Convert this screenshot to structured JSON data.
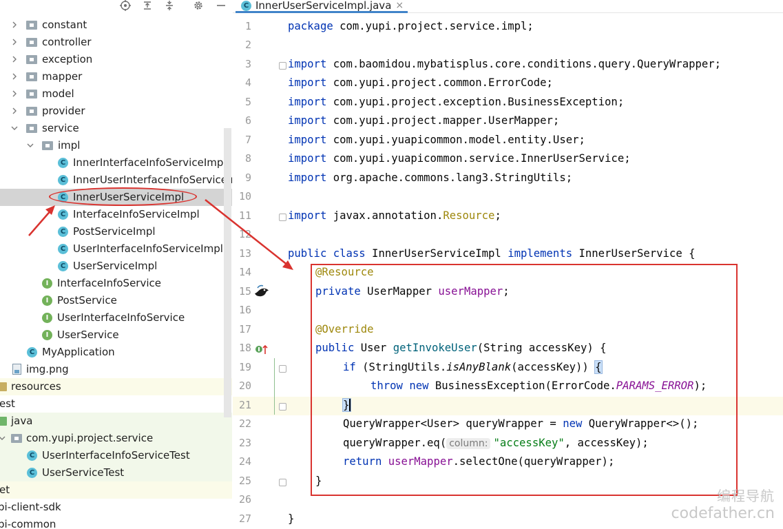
{
  "tree": {
    "items": [
      {
        "label": "constant",
        "type": "package"
      },
      {
        "label": "controller",
        "type": "package"
      },
      {
        "label": "exception",
        "type": "package"
      },
      {
        "label": "mapper",
        "type": "package"
      },
      {
        "label": "model",
        "type": "package"
      },
      {
        "label": "provider",
        "type": "package"
      },
      {
        "label": "service",
        "type": "package"
      },
      {
        "label": "impl",
        "type": "package"
      },
      {
        "label": "InnerInterfaceInfoServiceImpl",
        "type": "class"
      },
      {
        "label": "InnerUserInterfaceInfoServiceImpl",
        "type": "class"
      },
      {
        "label": "InnerUserServiceImpl",
        "type": "class"
      },
      {
        "label": "InterfaceInfoServiceImpl",
        "type": "class"
      },
      {
        "label": "PostServiceImpl",
        "type": "class"
      },
      {
        "label": "UserInterfaceInfoServiceImpl",
        "type": "class"
      },
      {
        "label": "UserServiceImpl",
        "type": "class"
      },
      {
        "label": "InterfaceInfoService",
        "type": "interface"
      },
      {
        "label": "PostService",
        "type": "interface"
      },
      {
        "label": "UserInterfaceInfoService",
        "type": "interface"
      },
      {
        "label": "UserService",
        "type": "interface"
      },
      {
        "label": "MyApplication",
        "type": "app-class"
      },
      {
        "label": "img.png",
        "type": "image"
      },
      {
        "label": "resources",
        "type": "resources"
      },
      {
        "label": "est",
        "type": "plain"
      },
      {
        "label": "java",
        "type": "java-folder"
      },
      {
        "label": "com.yupi.project.service",
        "type": "package"
      },
      {
        "label": "UserInterfaceInfoServiceTest",
        "type": "test-class"
      },
      {
        "label": "UserServiceTest",
        "type": "test-class"
      },
      {
        "label": "et",
        "type": "plain"
      },
      {
        "label": "pi-client-sdk",
        "type": "plain"
      },
      {
        "label": "pi-common",
        "type": "plain"
      }
    ]
  },
  "editor": {
    "tab": {
      "label": "InnerUserServiceImpl.java",
      "close": "×"
    },
    "line_numbers": [
      "1",
      "2",
      "3",
      "4",
      "5",
      "6",
      "7",
      "8",
      "9",
      "10",
      "11",
      "12",
      "13",
      "14",
      "15",
      "16",
      "17",
      "18",
      "19",
      "20",
      "21",
      "22",
      "23",
      "24",
      "25",
      "26",
      "27"
    ],
    "code": {
      "l1_kw": "package",
      "l1_rest": " com.yupi.project.service.impl;",
      "import_kw": "import",
      "l3": " com.baomidou.mybatisplus.core.conditions.query.QueryWrapper;",
      "l4": " com.yupi.project.common.ErrorCode;",
      "l5": " com.yupi.project.exception.BusinessException;",
      "l6": " com.yupi.project.mapper.UserMapper;",
      "l7": " com.yupi.yuapicommon.model.entity.User;",
      "l8": " com.yupi.yuapicommon.service.InnerUserService;",
      "l9": " org.apache.commons.lang3.StringUtils;",
      "l11_pre": " javax.annotation.",
      "l11_ann": "Resource",
      "l11_end": ";",
      "l13_kw1": "public class",
      "l13_name": " InnerUserServiceImpl ",
      "l13_kw2": "implements",
      "l13_rest": " InnerUserService {",
      "l14_ann": "@Resource",
      "l15_kw": "private",
      "l15_type": " UserMapper ",
      "l15_field": "userMapper",
      "l15_end": ";",
      "l17_ann": "@Override",
      "l18_kw": "public",
      "l18_type": " User ",
      "l18_method": "getInvokeUser",
      "l18_rest": "(String accessKey) {",
      "l19_kw": "if",
      "l19_pre": " (StringUtils.",
      "l19_call": "isAnyBlank",
      "l19_rest": "(accessKey)) ",
      "l19_brace": "{",
      "l20_kw1": "throw",
      "l20_kw2": " new",
      "l20_pre": " BusinessException(ErrorCode.",
      "l20_const": "PARAMS_ERROR",
      "l20_end": ");",
      "l21_brace": "}",
      "l22_pre": "QueryWrapper<User> queryWrapper = ",
      "l22_kw": "new",
      "l22_rest": " QueryWrapper<>();",
      "l23_pre": "queryWrapper.eq(",
      "l23_hint": "column:",
      "l23_str": "\"accessKey\"",
      "l23_rest": ", accessKey);",
      "l24_kw": "return",
      "l24_field": " userMapper",
      "l24_rest": ".selectOne(queryWrapper);",
      "l25": "}",
      "l27": "}"
    }
  },
  "watermark": {
    "top": "编程导航",
    "bottom": "codefather.cn"
  },
  "colors": {
    "annotation_red": "#d9332f",
    "keyword": "#0033b3",
    "annotation": "#9e880d",
    "field": "#871094",
    "string": "#067d17"
  }
}
